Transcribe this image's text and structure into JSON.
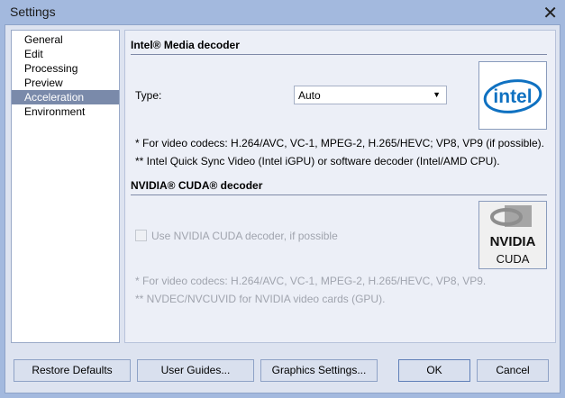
{
  "window": {
    "title": "Settings"
  },
  "sidebar": {
    "items": [
      {
        "label": "General"
      },
      {
        "label": "Edit"
      },
      {
        "label": "Processing"
      },
      {
        "label": "Preview"
      },
      {
        "label": "Acceleration",
        "selected": true
      },
      {
        "label": "Environment"
      }
    ]
  },
  "intel": {
    "heading": "Intel® Media decoder",
    "type_label": "Type:",
    "type_value": "Auto",
    "note1": "*  For video codecs: H.264/AVC, VC-1, MPEG-2, H.265/HEVC; VP8, VP9 (if possible).",
    "note2": "** Intel Quick Sync Video (Intel iGPU) or software decoder (Intel/AMD CPU).",
    "logo_text": "intel"
  },
  "nvidia": {
    "heading": "NVIDIA® CUDA® decoder",
    "checkbox_label": "Use NVIDIA CUDA decoder, if possible",
    "checkbox_checked": false,
    "note1": "*  For video codecs: H.264/AVC, VC-1, MPEG-2, H.265/HEVC, VP8, VP9.",
    "note2": "** NVDEC/NVCUVID for NVIDIA video cards (GPU).",
    "logo_text": "NVIDIA",
    "logo_sub": "CUDA"
  },
  "buttons": {
    "restore": "Restore Defaults",
    "guides": "User Guides...",
    "graphics": "Graphics Settings...",
    "ok": "OK",
    "cancel": "Cancel"
  }
}
